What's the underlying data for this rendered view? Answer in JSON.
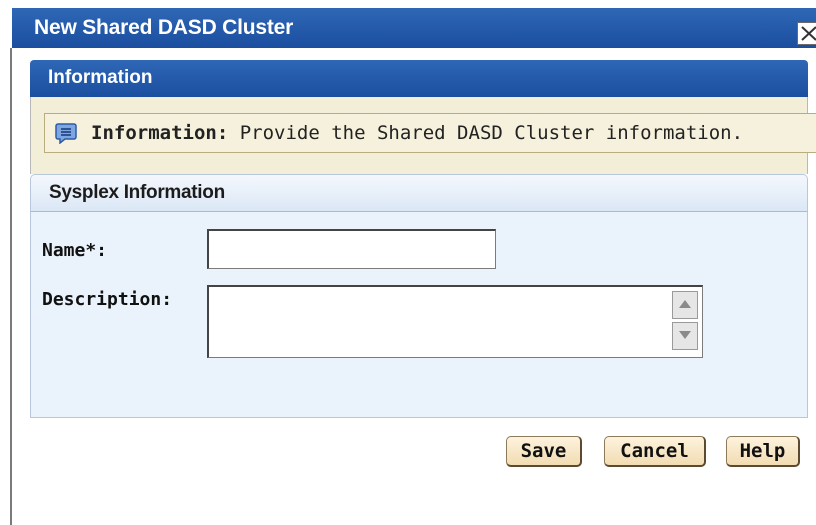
{
  "dialog": {
    "title": "New Shared DASD Cluster",
    "close_icon": "close-icon"
  },
  "information": {
    "header": "Information",
    "icon": "info-message-icon",
    "label": "Information:",
    "message": " Provide the Shared DASD Cluster information."
  },
  "sysplex": {
    "header": "Sysplex Information",
    "name_label": "Name*:",
    "name_value": "",
    "description_label": "Description:",
    "description_value": ""
  },
  "buttons": {
    "save": "Save",
    "cancel": "Cancel",
    "help": "Help"
  },
  "colors": {
    "titlebar": "#1f56a8",
    "info_panel": "#f3eed8",
    "section_body": "#eaf2fb",
    "button": "#f6e6c4"
  }
}
